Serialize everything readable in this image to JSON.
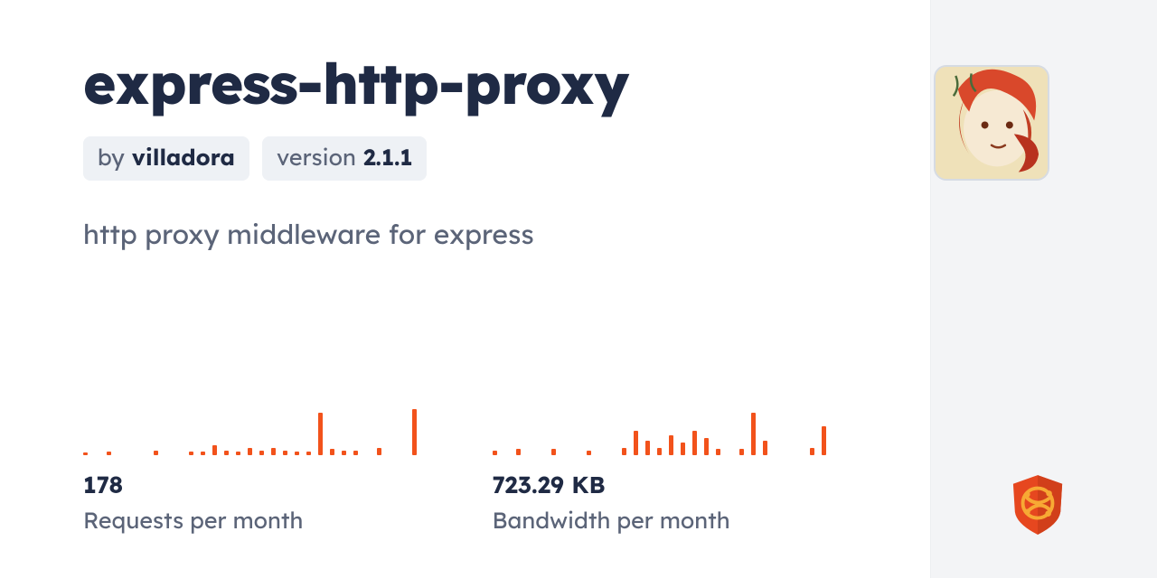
{
  "package": {
    "name": "express-http-proxy",
    "author_prefix": "by",
    "author": "villadora",
    "version_prefix": "version",
    "version": "2.1.1",
    "description": "http proxy middleware for express"
  },
  "stats": {
    "requests": {
      "value": "178",
      "label": "Requests per month"
    },
    "bandwidth": {
      "value": "723.29 KB",
      "label": "Bandwidth per month"
    }
  },
  "colors": {
    "accent": "#f2521b"
  },
  "chart_data": [
    {
      "type": "bar",
      "title": "Requests per month sparkline",
      "values": [
        2,
        0,
        3,
        0,
        0,
        0,
        4,
        0,
        0,
        3,
        3,
        8,
        4,
        3,
        6,
        4,
        6,
        4,
        3,
        3,
        35,
        5,
        4,
        4,
        0,
        6,
        0,
        0,
        38,
        0
      ],
      "ylim": [
        0,
        40
      ]
    },
    {
      "type": "bar",
      "title": "Bandwidth per month sparkline",
      "values": [
        4,
        0,
        5,
        0,
        0,
        5,
        0,
        0,
        4,
        0,
        0,
        6,
        20,
        12,
        6,
        16,
        10,
        20,
        14,
        5,
        0,
        5,
        35,
        12,
        0,
        0,
        0,
        6,
        24,
        0
      ],
      "ylim": [
        0,
        40
      ]
    }
  ]
}
